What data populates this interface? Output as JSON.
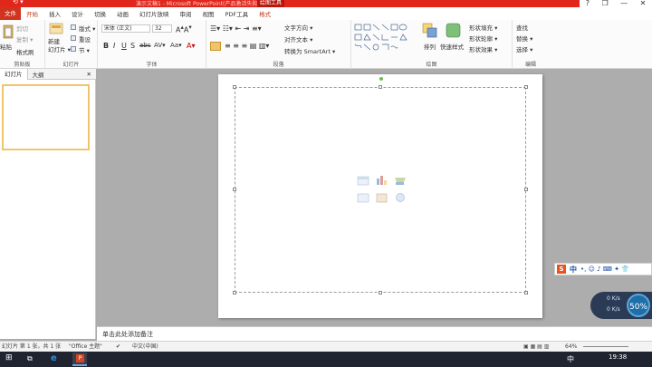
{
  "titlebar": {
    "title": "演示文稿1 - Microsoft PowerPoint(产品激活失败)",
    "context_tab_group": "绘图工具"
  },
  "window_controls": {
    "help": "?",
    "restore": "❐",
    "minimize": "—",
    "close": "✕"
  },
  "tabs": [
    {
      "label": "文件"
    },
    {
      "label": "开始"
    },
    {
      "label": "插入"
    },
    {
      "label": "设计"
    },
    {
      "label": "切换"
    },
    {
      "label": "动画"
    },
    {
      "label": "幻灯片放映"
    },
    {
      "label": "审阅"
    },
    {
      "label": "视图"
    },
    {
      "label": "PDF工具"
    },
    {
      "label": "格式"
    }
  ],
  "ribbon": {
    "clipboard": {
      "paste": "粘贴",
      "cut": "剪切",
      "copy": "复制 ▾",
      "format_painter": "格式刷",
      "label": "剪贴板"
    },
    "slides": {
      "new_slide": "新建\n幻灯片 ▾",
      "layout": "版式 ▾",
      "reset": "重设",
      "section": "节 ▾",
      "label": "幻灯片"
    },
    "font": {
      "font_name": "宋体 (正文)",
      "font_size": "32",
      "label": "字体"
    },
    "paragraph": {
      "text_direction": "文字方向 ▾",
      "align_text": "对齐文本 ▾",
      "smartart": "转换为 SmartArt ▾",
      "label": "段落"
    },
    "drawing": {
      "arrange": "排列",
      "quick_styles": "快速样式",
      "shape_fill": "形状填充 ▾",
      "shape_outline": "形状轮廓 ▾",
      "shape_effects": "形状效果 ▾",
      "label": "绘图"
    },
    "editing": {
      "find": "查找",
      "replace": "替换 ▾",
      "select": "选择 ▾",
      "label": "编辑"
    }
  },
  "left_pane": {
    "tab_slides": "幻灯片",
    "tab_outline": "大纲",
    "close": "✕",
    "slide_number": "1"
  },
  "notes": {
    "placeholder": "单击此处添加备注"
  },
  "status": {
    "slide_info": "幻灯片 第 1 张，共 1 张",
    "theme": "\"Office 主题\"",
    "language": "中文(中国)",
    "zoom": "64%"
  },
  "ime": {
    "label": "中"
  },
  "net_speed": {
    "up": "0 K/s",
    "down": "0 K/s",
    "percent": "50%"
  },
  "taskbar": {
    "time": "19:38",
    "ime": "中"
  }
}
